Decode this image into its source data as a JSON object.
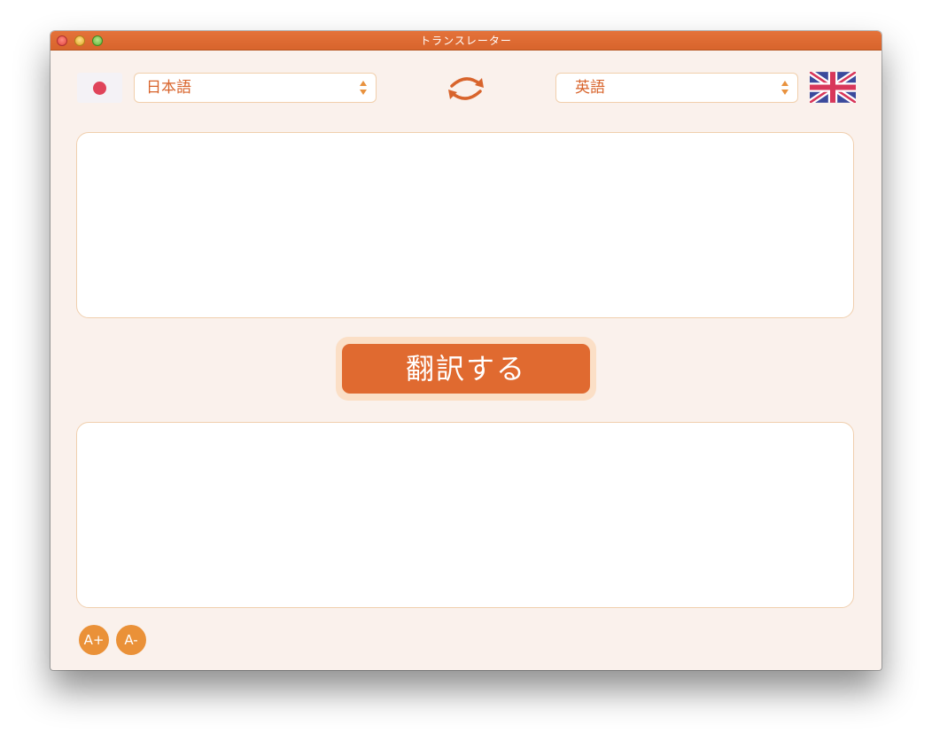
{
  "window": {
    "title": "トランスレーター"
  },
  "source_language": {
    "flag_icon": "japan-flag-icon",
    "selected": "日本語"
  },
  "target_language": {
    "flag_icon": "uk-flag-icon",
    "selected": "英語"
  },
  "swap_icon": "swap-arrows-icon",
  "input_text": "",
  "output_text": "",
  "translate_button": {
    "label": "翻訳する"
  },
  "font_controls": {
    "increase_label": "A+",
    "decrease_label": "A-"
  },
  "colors": {
    "accent": "#e06a30",
    "background": "#faf1ec",
    "border": "#f0cfae",
    "font_button": "#ea9138"
  }
}
